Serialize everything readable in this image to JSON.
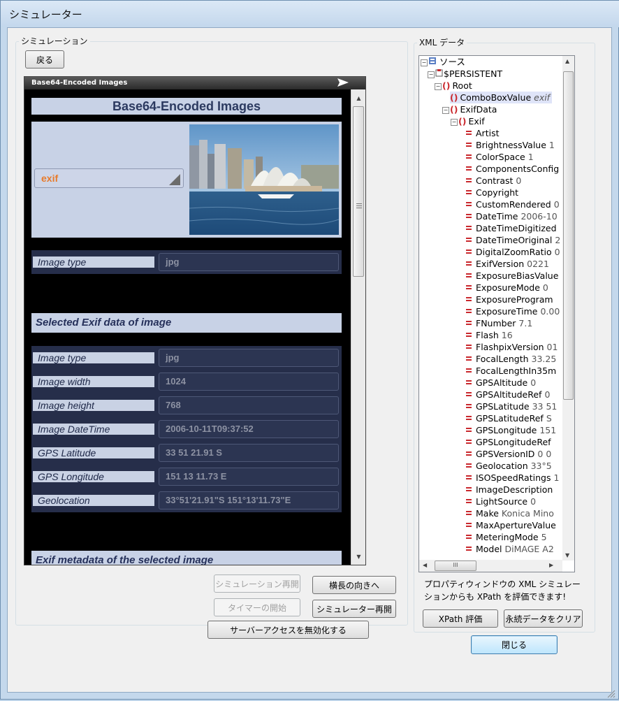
{
  "window": {
    "title": "シミュレーター"
  },
  "sim": {
    "group_label": "シミュレーション",
    "back_label": "戻る",
    "header_title": "Base64-Encoded Images",
    "page_title": "Base64-Encoded Images",
    "combo_value": "exif",
    "image_type_row": {
      "label": "Image type",
      "value": "jpg"
    },
    "section1": "Selected Exif data of image",
    "rows": [
      {
        "label": "Image type",
        "value": "jpg"
      },
      {
        "label": "Image width",
        "value": "1024"
      },
      {
        "label": "Image height",
        "value": "768"
      },
      {
        "label": "Image DateTime",
        "value": "2006-10-11T09:37:52"
      },
      {
        "label": "GPS Latitude",
        "value": "33 51 21.91 S"
      },
      {
        "label": "GPS Longitude",
        "value": "151 13 11.73 E"
      },
      {
        "label": "Geolocation",
        "value": "33°51'21.91\"S 151°13'11.73\"E"
      }
    ],
    "section2": "Exif metadata of the selected image"
  },
  "buttons": {
    "restart_sim": "シミュレーション再開",
    "landscape": "横長の向きへ",
    "timer_start": "タイマーの開始",
    "restart_simulator": "シミュレーター再開",
    "disable_server": "サーバーアクセスを無効化する",
    "xpath_eval": "XPath 評価",
    "clear_persistent": "永続データをクリア",
    "close": "閉じる"
  },
  "xml": {
    "group_label": "XML データ",
    "source": "ソース",
    "persistent": "$PERSISTENT",
    "root": "Root",
    "combo_key": "ComboBoxValue",
    "combo_val": "exif",
    "exifdata": "ExifData",
    "exif": "Exif",
    "items": [
      {
        "k": "Artist",
        "v": ""
      },
      {
        "k": "BrightnessValue",
        "v": "1"
      },
      {
        "k": "ColorSpace",
        "v": "1"
      },
      {
        "k": "ComponentsConfig",
        "v": ""
      },
      {
        "k": "Contrast",
        "v": "0"
      },
      {
        "k": "Copyright",
        "v": ""
      },
      {
        "k": "CustomRendered",
        "v": "0"
      },
      {
        "k": "DateTime",
        "v": "2006-10"
      },
      {
        "k": "DateTimeDigitized",
        "v": ""
      },
      {
        "k": "DateTimeOriginal",
        "v": "2"
      },
      {
        "k": "DigitalZoomRatio",
        "v": "0"
      },
      {
        "k": "ExifVersion",
        "v": "0221"
      },
      {
        "k": "ExposureBiasValue",
        "v": ""
      },
      {
        "k": "ExposureMode",
        "v": "0"
      },
      {
        "k": "ExposureProgram",
        "v": ""
      },
      {
        "k": "ExposureTime",
        "v": "0.00"
      },
      {
        "k": "FNumber",
        "v": "7.1"
      },
      {
        "k": "Flash",
        "v": "16"
      },
      {
        "k": "FlashpixVersion",
        "v": "01"
      },
      {
        "k": "FocalLength",
        "v": "33.25"
      },
      {
        "k": "FocalLengthIn35m",
        "v": ""
      },
      {
        "k": "GPSAltitude",
        "v": "0"
      },
      {
        "k": "GPSAltitudeRef",
        "v": "0"
      },
      {
        "k": "GPSLatitude",
        "v": "33 51"
      },
      {
        "k": "GPSLatitudeRef",
        "v": "S"
      },
      {
        "k": "GPSLongitude",
        "v": "151"
      },
      {
        "k": "GPSLongitudeRef",
        "v": ""
      },
      {
        "k": "GPSVersionID",
        "v": "0 0"
      },
      {
        "k": "Geolocation",
        "v": "33°5"
      },
      {
        "k": "ISOSpeedRatings",
        "v": "1"
      },
      {
        "k": "ImageDescription",
        "v": ""
      },
      {
        "k": "LightSource",
        "v": "0"
      },
      {
        "k": "Make",
        "v": "Konica Mino"
      },
      {
        "k": "MaxApertureValue",
        "v": ""
      },
      {
        "k": "MeteringMode",
        "v": "5"
      },
      {
        "k": "Model",
        "v": "DiMAGE A2"
      }
    ],
    "hint": "プロパティウィンドウの XML シミュレーションからも XPath を評価できます!"
  }
}
